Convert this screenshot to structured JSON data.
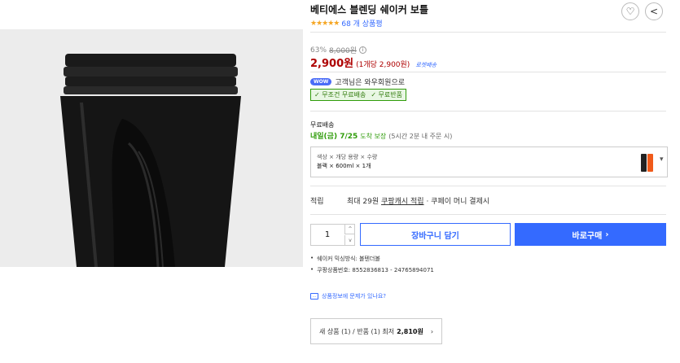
{
  "product": {
    "title": "베티에스 블렌딩 쉐이커 보틀",
    "rating_stars": "★★★★★",
    "review_count": "68 개 상품평",
    "discount_rate": "63%",
    "original_price": "8,000원",
    "price": "2,900원",
    "unit_price": "(1개당 2,900원)",
    "rocket_label": "로켓배송"
  },
  "actions": {
    "heart_icon": "♡",
    "share_icon": "<"
  },
  "wow": {
    "badge": "WOW",
    "text": "고객님은 와우회원으로",
    "benefit_1": "✓ 무조건 무료배송",
    "benefit_2": "✓ 무료반품"
  },
  "shipping": {
    "label": "무료배송",
    "date_highlight": "내일(금) 7/25",
    "date_suffix": "도착 보장",
    "condition": "(5시간 2분 내 주문 시)"
  },
  "option": {
    "labels": "색상 × 개당 용량 × 수량",
    "values": "블랙 × 600ml × 1개",
    "caret": "▾"
  },
  "points": {
    "title": "적립",
    "text_prefix": "최대 29원",
    "link": "쿠팡캐시 적립",
    "text_suffix": "· 쿠페이 머니 결제시"
  },
  "purchase": {
    "quantity": "1",
    "step_up": "^",
    "step_down": "v",
    "cart_label": "장바구니 담기",
    "buy_label": "바로구매",
    "buy_arrow": "›"
  },
  "details": {
    "bullet_1": "쉐이커 믹싱방식: 볼텐더볼",
    "bullet_2": "쿠팡상품번호: 8552836813 - 24765894071"
  },
  "report": {
    "text": "상품정보에 문제가 있나요?"
  },
  "other_sellers": {
    "text": "새 상품 (1) / 반품 (1) 최저",
    "lowest": "2,810원",
    "arrow": "›"
  },
  "colors": {
    "accent_blue": "#346aff",
    "price_red": "#ae0000",
    "rocket_green": "#2f9c0a"
  }
}
